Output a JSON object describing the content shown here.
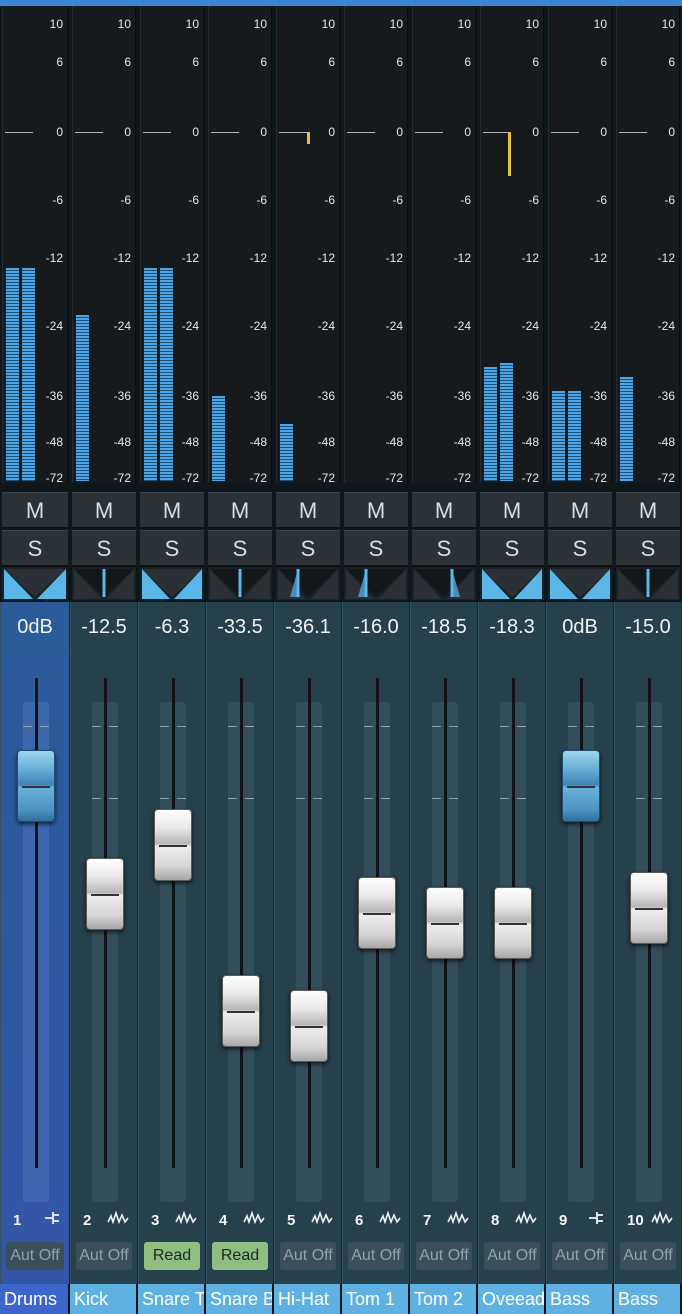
{
  "scale": [
    "10",
    "6",
    "0",
    "-6",
    "-12",
    "-24",
    "-36",
    "-48",
    "-72"
  ],
  "mute_label": "M",
  "solo_label": "S",
  "channels": [
    {
      "number": "1",
      "name": "Drums",
      "volume": "0dB",
      "automation": "Aut Off",
      "icon": "folder-routing-icon",
      "selected": true,
      "levels": [
        0.45,
        0.45
      ],
      "peak": null,
      "fader": 0.78,
      "pan": "center"
    },
    {
      "number": "2",
      "name": "Kick",
      "volume": "-12.5",
      "automation": "Aut Off",
      "icon": "waveform-icon",
      "selected": false,
      "levels": [
        0.35
      ],
      "peak": null,
      "fader": 0.56,
      "pan": "center"
    },
    {
      "number": "3",
      "name": "Snare Top",
      "volume": "-6.3",
      "automation": "Read",
      "icon": "waveform-icon",
      "selected": false,
      "levels": [
        0.45,
        0.45
      ],
      "peak": null,
      "fader": 0.66,
      "pan": "center"
    },
    {
      "number": "4",
      "name": "Snare Bottom",
      "volume": "-33.5",
      "automation": "Read",
      "icon": "waveform-icon",
      "selected": false,
      "levels": [
        0.18
      ],
      "peak": null,
      "fader": 0.32,
      "pan": "center"
    },
    {
      "number": "5",
      "name": "Hi-Hat",
      "volume": "-36.1",
      "automation": "Aut Off",
      "icon": "waveform-icon",
      "selected": false,
      "levels": [
        0.12
      ],
      "peak": 0.73,
      "fader": 0.29,
      "pan": "left"
    },
    {
      "number": "6",
      "name": "Tom 1",
      "volume": "-16.0",
      "automation": "Aut Off",
      "icon": "waveform-icon",
      "selected": false,
      "levels": [],
      "peak": null,
      "fader": 0.52,
      "pan": "left"
    },
    {
      "number": "7",
      "name": "Tom 2",
      "volume": "-18.5",
      "automation": "Aut Off",
      "icon": "waveform-icon",
      "selected": false,
      "levels": [],
      "peak": null,
      "fader": 0.5,
      "pan": "right"
    },
    {
      "number": "8",
      "name": "Oveeads",
      "volume": "-18.3",
      "automation": "Aut Off",
      "icon": "waveform-icon",
      "selected": false,
      "levels": [
        0.24,
        0.25
      ],
      "peak": 0.73,
      "fader": 0.5,
      "pan": "center"
    },
    {
      "number": "9",
      "name": "Bass",
      "volume": "0dB",
      "automation": "Aut Off",
      "icon": "folder-routing-icon",
      "selected": false,
      "levels": [
        0.19,
        0.19
      ],
      "peak": null,
      "fader": 0.78,
      "pan": "center"
    },
    {
      "number": "10",
      "name": "Bass",
      "volume": "-15.0",
      "automation": "Aut Off",
      "icon": "waveform-icon",
      "selected": false,
      "levels": [
        0.22
      ],
      "peak": null,
      "fader": 0.53,
      "pan": "center"
    }
  ]
}
